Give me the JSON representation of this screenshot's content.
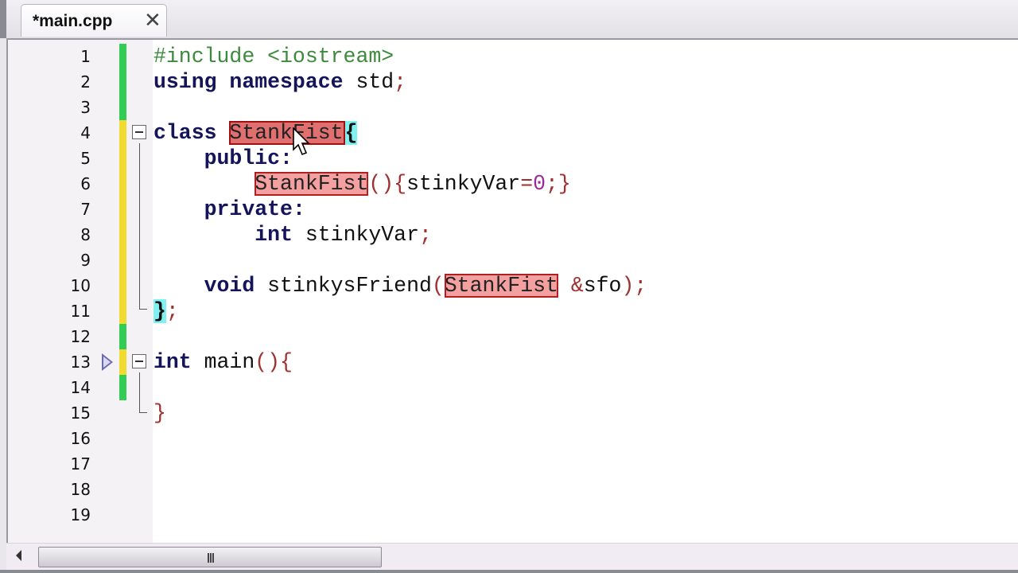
{
  "tab": {
    "label": "*main.cpp",
    "close_icon": "close-icon"
  },
  "colors": {
    "added": "#33cc55",
    "modified": "#f0dc30",
    "highlight": "#f4a0a0",
    "bracket_match": "#80f0f0"
  },
  "lines": [
    {
      "n": "1",
      "chg": "added",
      "tokens": [
        [
          "pp",
          "#include <iostream>"
        ]
      ]
    },
    {
      "n": "2",
      "chg": "added",
      "tokens": [
        [
          "k",
          "using namespace "
        ],
        [
          "n",
          "std"
        ],
        [
          "p",
          ";"
        ]
      ]
    },
    {
      "n": "3",
      "chg": "added",
      "tokens": []
    },
    {
      "n": "4",
      "chg": "modified",
      "fold": true,
      "tokens": [
        [
          "k",
          "class "
        ],
        [
          "hl2",
          "StankFist"
        ],
        [
          "br",
          "{"
        ]
      ]
    },
    {
      "n": "5",
      "chg": "modified",
      "tokens": [
        [
          "n",
          "    "
        ],
        [
          "k",
          "public:"
        ]
      ]
    },
    {
      "n": "6",
      "chg": "modified",
      "tokens": [
        [
          "n",
          "        "
        ],
        [
          "hl",
          "StankFist"
        ],
        [
          "p",
          "(){"
        ],
        [
          "n",
          "stinkyVar"
        ],
        [
          "p",
          "="
        ],
        [
          "num",
          "0"
        ],
        [
          "p",
          ";}"
        ]
      ]
    },
    {
      "n": "7",
      "chg": "modified",
      "tokens": [
        [
          "n",
          "    "
        ],
        [
          "k",
          "private:"
        ]
      ]
    },
    {
      "n": "8",
      "chg": "modified",
      "tokens": [
        [
          "n",
          "        "
        ],
        [
          "k",
          "int "
        ],
        [
          "n",
          "stinkyVar"
        ],
        [
          "p",
          ";"
        ]
      ]
    },
    {
      "n": "9",
      "chg": "modified",
      "tokens": []
    },
    {
      "n": "10",
      "chg": "modified",
      "tokens": [
        [
          "n",
          "    "
        ],
        [
          "k",
          "void "
        ],
        [
          "n",
          "stinkysFriend"
        ],
        [
          "p",
          "("
        ],
        [
          "hl",
          "StankFist"
        ],
        [
          "n",
          " "
        ],
        [
          "p",
          "&"
        ],
        [
          "n",
          "sfo"
        ],
        [
          "p",
          ");"
        ]
      ]
    },
    {
      "n": "11",
      "chg": "modified",
      "tokens": [
        [
          "br",
          "}"
        ],
        [
          "p",
          ";"
        ]
      ]
    },
    {
      "n": "12",
      "chg": "added",
      "tokens": []
    },
    {
      "n": "13",
      "chg": "modified",
      "fold": true,
      "bp": true,
      "tokens": [
        [
          "k",
          "int "
        ],
        [
          "n",
          "main"
        ],
        [
          "p",
          "(){"
        ]
      ]
    },
    {
      "n": "14",
      "chg": "added",
      "tokens": []
    },
    {
      "n": "15",
      "tokens": [
        [
          "p",
          "}"
        ]
      ]
    },
    {
      "n": "16",
      "tokens": []
    },
    {
      "n": "17",
      "tokens": []
    },
    {
      "n": "18",
      "tokens": []
    },
    {
      "n": "19",
      "tokens": []
    }
  ]
}
